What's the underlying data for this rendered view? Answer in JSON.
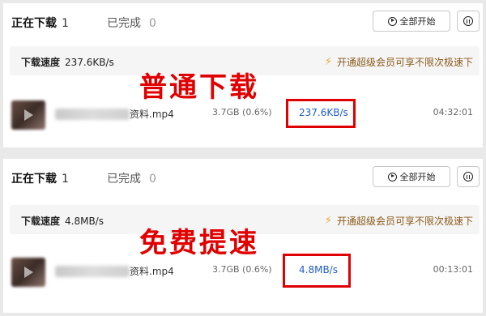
{
  "colors": {
    "accent_blue": "#1e5cc8",
    "watermark_red": "#e00000",
    "promo_brown": "#8a5a1a",
    "bolt_orange": "#f0a52b"
  },
  "panels": [
    {
      "tab_active_label": "正在下载",
      "tab_active_count": "1",
      "tab_inactive_label": "已完成",
      "tab_inactive_count": "0",
      "start_all_label": "全部开始",
      "speed_label": "下载速度",
      "speed_value": "237.6KB/s",
      "promo_text": "开通超级会员可享不限次极速下",
      "watermark": "普通下载",
      "file": {
        "name_suffix": "资料.mp4",
        "size": "3.7GB (0.6%)",
        "speed": "237.6KB/s",
        "time_left": "04:32:01"
      }
    },
    {
      "tab_active_label": "正在下载",
      "tab_active_count": "1",
      "tab_inactive_label": "已完成",
      "tab_inactive_count": "0",
      "start_all_label": "全部开始",
      "speed_label": "下载速度",
      "speed_value": "4.8MB/s",
      "promo_text": "开通超级会员可享不限次极速下",
      "watermark": "免费提速",
      "file": {
        "name_suffix": "资料.mp4",
        "size": "3.7GB (0.6%)",
        "speed": "4.8MB/s",
        "time_left": "00:13:01"
      }
    }
  ]
}
